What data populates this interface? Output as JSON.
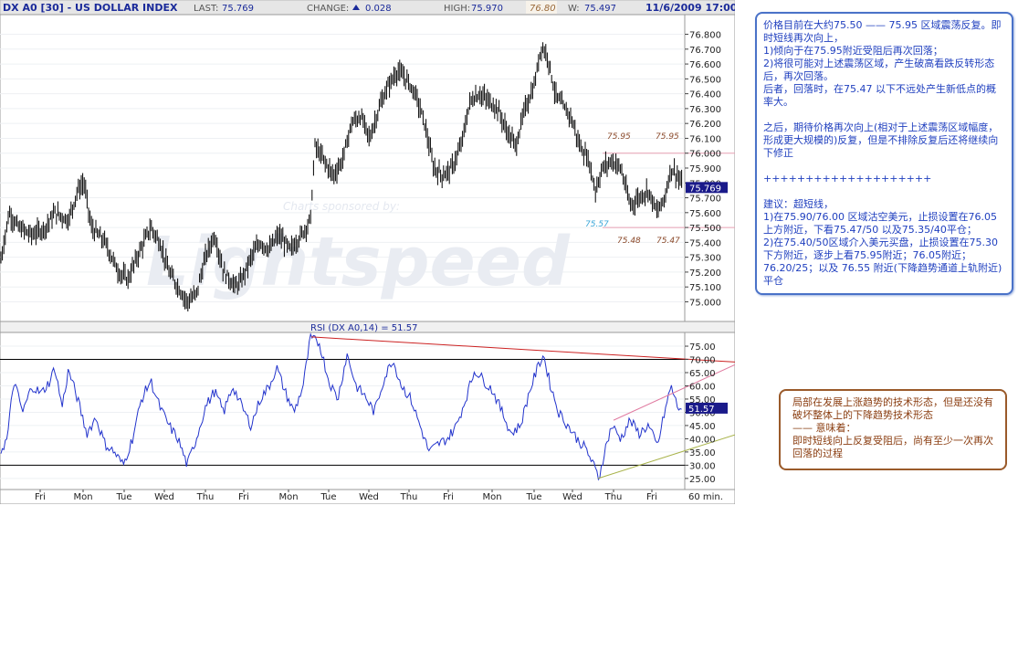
{
  "header": {
    "symbol": "DX A0 [30] - US DOLLAR INDEX",
    "last_label": "LAST:",
    "last_value": "75.769",
    "change_label": "CHANGE:",
    "change_value": "0.028",
    "high_label": "HIGH:",
    "high_value": "75.970",
    "peak_value": "76.80",
    "low_label": "W:",
    "low_value": "75.497",
    "datetime": "11/6/2009 17:00"
  },
  "chart_data": [
    {
      "type": "ohlc",
      "ylim": [
        74.88,
        76.92
      ],
      "y_ticks": [
        "76.800",
        "76.700",
        "76.600",
        "76.500",
        "76.400",
        "76.300",
        "76.200",
        "76.100",
        "76.000",
        "75.900",
        "75.800",
        "75.700",
        "75.600",
        "75.500",
        "75.400",
        "75.300",
        "75.200",
        "75.100",
        "75.000"
      ],
      "last_price_label": "75.769",
      "x_labels": [
        "Fri",
        "Mon",
        "Tue",
        "Wed",
        "Thu",
        "Fri",
        "Mon",
        "Tue",
        "Wed",
        "Thu",
        "Fri",
        "Mon",
        "Tue",
        "Wed",
        "Thu",
        "Fri"
      ],
      "watermark_sponsor": "Charts sponsored by:",
      "watermark_logo": "Lightspeed",
      "annotations": [
        {
          "text": "75.95",
          "color": "#8b4a2b"
        },
        {
          "text": "75.95",
          "color": "#8b4a2b"
        },
        {
          "text": "75.57",
          "color": "#3aa6d8"
        },
        {
          "text": "75.48",
          "color": "#8b4a2b"
        },
        {
          "text": "75.47",
          "color": "#8b4a2b"
        }
      ],
      "reference_lines": [
        76.0,
        75.5
      ],
      "series": [
        {
          "name": "DX A0",
          "anchors": [
            [
              0,
              75.25
            ],
            [
              10,
              75.6
            ],
            [
              20,
              75.5
            ],
            [
              35,
              75.45
            ],
            [
              50,
              75.5
            ],
            [
              60,
              75.6
            ],
            [
              75,
              75.55
            ],
            [
              85,
              75.75
            ],
            [
              92,
              75.8
            ],
            [
              100,
              75.5
            ],
            [
              115,
              75.4
            ],
            [
              130,
              75.2
            ],
            [
              140,
              75.15
            ],
            [
              150,
              75.3
            ],
            [
              165,
              75.5
            ],
            [
              175,
              75.4
            ],
            [
              185,
              75.2
            ],
            [
              195,
              75.1
            ],
            [
              205,
              75.0
            ],
            [
              215,
              75.05
            ],
            [
              225,
              75.3
            ],
            [
              235,
              75.45
            ],
            [
              245,
              75.2
            ],
            [
              258,
              75.1
            ],
            [
              265,
              75.15
            ],
            [
              275,
              75.3
            ],
            [
              285,
              75.4
            ],
            [
              295,
              75.35
            ],
            [
              305,
              75.45
            ],
            [
              318,
              75.35
            ],
            [
              330,
              75.45
            ],
            [
              340,
              75.55
            ],
            [
              345,
              76.05
            ],
            [
              355,
              75.95
            ],
            [
              365,
              75.85
            ],
            [
              375,
              75.95
            ],
            [
              385,
              76.2
            ],
            [
              395,
              76.25
            ],
            [
              405,
              76.1
            ],
            [
              415,
              76.3
            ],
            [
              425,
              76.45
            ],
            [
              435,
              76.55
            ],
            [
              445,
              76.5
            ],
            [
              455,
              76.4
            ],
            [
              465,
              76.2
            ],
            [
              475,
              75.9
            ],
            [
              485,
              75.85
            ],
            [
              495,
              75.9
            ],
            [
              505,
              76.05
            ],
            [
              515,
              76.35
            ],
            [
              525,
              76.4
            ],
            [
              535,
              76.35
            ],
            [
              545,
              76.3
            ],
            [
              555,
              76.15
            ],
            [
              565,
              76.05
            ],
            [
              575,
              76.3
            ],
            [
              585,
              76.45
            ],
            [
              593,
              76.72
            ],
            [
              600,
              76.65
            ],
            [
              608,
              76.4
            ],
            [
              618,
              76.3
            ],
            [
              625,
              76.25
            ],
            [
              635,
              76.05
            ],
            [
              645,
              75.95
            ],
            [
              652,
              75.75
            ],
            [
              660,
              75.9
            ],
            [
              670,
              75.95
            ],
            [
              680,
              75.9
            ],
            [
              690,
              75.65
            ],
            [
              700,
              75.7
            ],
            [
              710,
              75.75
            ],
            [
              720,
              75.6
            ],
            [
              728,
              75.7
            ],
            [
              735,
              75.9
            ],
            [
              742,
              75.85
            ],
            [
              748,
              75.77
            ]
          ]
        }
      ]
    },
    {
      "type": "line",
      "title": "RSI (DX A0,14) = 51.57",
      "ylim": [
        21.5,
        79.5
      ],
      "y_ticks": [
        "75.00",
        "70.00",
        "65.00",
        "60.00",
        "55.00",
        "50.00",
        "45.00",
        "40.00",
        "35.00",
        "30.00",
        "25.00"
      ],
      "last_value_label": "51.57",
      "reference_lines": [
        70,
        30
      ],
      "series": [
        {
          "name": "RSI",
          "anchors": [
            [
              0,
              35
            ],
            [
              8,
              40
            ],
            [
              15,
              62
            ],
            [
              25,
              50
            ],
            [
              35,
              60
            ],
            [
              45,
              57
            ],
            [
              55,
              62
            ],
            [
              60,
              67
            ],
            [
              68,
              52
            ],
            [
              75,
              66
            ],
            [
              85,
              55
            ],
            [
              95,
              42
            ],
            [
              105,
              48
            ],
            [
              115,
              38
            ],
            [
              125,
              35
            ],
            [
              135,
              30
            ],
            [
              145,
              40
            ],
            [
              155,
              55
            ],
            [
              165,
              62
            ],
            [
              175,
              52
            ],
            [
              185,
              45
            ],
            [
              195,
              40
            ],
            [
              205,
              30
            ],
            [
              215,
              40
            ],
            [
              225,
              52
            ],
            [
              235,
              58
            ],
            [
              245,
              50
            ],
            [
              255,
              60
            ],
            [
              265,
              52
            ],
            [
              275,
              45
            ],
            [
              285,
              55
            ],
            [
              295,
              60
            ],
            [
              303,
              67
            ],
            [
              312,
              58
            ],
            [
              322,
              50
            ],
            [
              332,
              60
            ],
            [
              340,
              78
            ],
            [
              350,
              76
            ],
            [
              360,
              62
            ],
            [
              370,
              55
            ],
            [
              380,
              72
            ],
            [
              390,
              60
            ],
            [
              400,
              56
            ],
            [
              410,
              50
            ],
            [
              420,
              62
            ],
            [
              430,
              70
            ],
            [
              440,
              60
            ],
            [
              450,
              55
            ],
            [
              460,
              45
            ],
            [
              470,
              35
            ],
            [
              480,
              38
            ],
            [
              490,
              40
            ],
            [
              500,
              45
            ],
            [
              510,
              55
            ],
            [
              520,
              66
            ],
            [
              530,
              62
            ],
            [
              540,
              58
            ],
            [
              550,
              50
            ],
            [
              560,
              42
            ],
            [
              570,
              45
            ],
            [
              580,
              58
            ],
            [
              588,
              66
            ],
            [
              595,
              72
            ],
            [
              603,
              60
            ],
            [
              612,
              50
            ],
            [
              622,
              45
            ],
            [
              632,
              40
            ],
            [
              642,
              36
            ],
            [
              650,
              30
            ],
            [
              656,
              25
            ],
            [
              662,
              35
            ],
            [
              670,
              45
            ],
            [
              680,
              40
            ],
            [
              690,
              47
            ],
            [
              700,
              42
            ],
            [
              710,
              45
            ],
            [
              720,
              37
            ],
            [
              728,
              50
            ],
            [
              735,
              60
            ],
            [
              742,
              52
            ],
            [
              748,
              51.57
            ]
          ]
        }
      ],
      "trendlines": [
        {
          "name": "resistance-line",
          "color": "#cc2222",
          "from": [
            341,
            78.5
          ],
          "to": [
            805,
            69
          ]
        },
        {
          "name": "upper-channel-line",
          "color": "#e07aa0",
          "from": [
            672,
            47
          ],
          "to": [
            805,
            68
          ]
        },
        {
          "name": "lower-channel-line",
          "color": "#a8b34a",
          "from": [
            655,
            25
          ],
          "to": [
            805,
            41.5
          ]
        }
      ]
    }
  ],
  "x_axis": {
    "labels": [
      "Fri",
      "Mon",
      "Tue",
      "Wed",
      "Thu",
      "Fri",
      "Mon",
      "Tue",
      "Wed",
      "Thu",
      "Fri",
      "Mon",
      "Tue",
      "Wed",
      "Thu",
      "Fri"
    ],
    "interval_label": "60 min."
  },
  "notes": {
    "blue": {
      "color": "#1f3fbf",
      "paragraphs": [
        "价格目前在大约75.50 —— 75.95 区域震荡反复。即时短线再次向上，",
        "1)倾向于在75.95附近受阻后再次回落；",
        "2)将很可能对上述震荡区域，产生破高看跌反转形态后，再次回落。",
        "后者，回落时，在75.47 以下不远处产生新低点的概率大。",
        "",
        "之后，期待价格再次向上(相对于上述震荡区域幅度，形成更大规模的)反复，但是不排除反复后还将继续向下修正",
        "",
        "++++++++++++++++++++",
        "",
        "建议：超短线，",
        "1)在75.90/76.00 区域沽空美元，止损设置在76.05上方附近，下看75.47/50 以及75.35/40平仓；",
        "2)在75.40/50区域介入美元买盘，止损设置在75.30 下方附近，逐步上看75.95附近；76.05附近；76.20/25；以及 76.55 附近(下降趋势通道上轨附近)平仓"
      ]
    },
    "brown": {
      "color": "#8a3d10",
      "paragraphs": [
        "局部在发展上涨趋势的技术形态，但是还没有破坏整体上的下降趋势技术形态",
        "—— 意味着：",
        "即时短线向上反复受阻后，尚有至少一次再次回落的过程"
      ]
    }
  }
}
